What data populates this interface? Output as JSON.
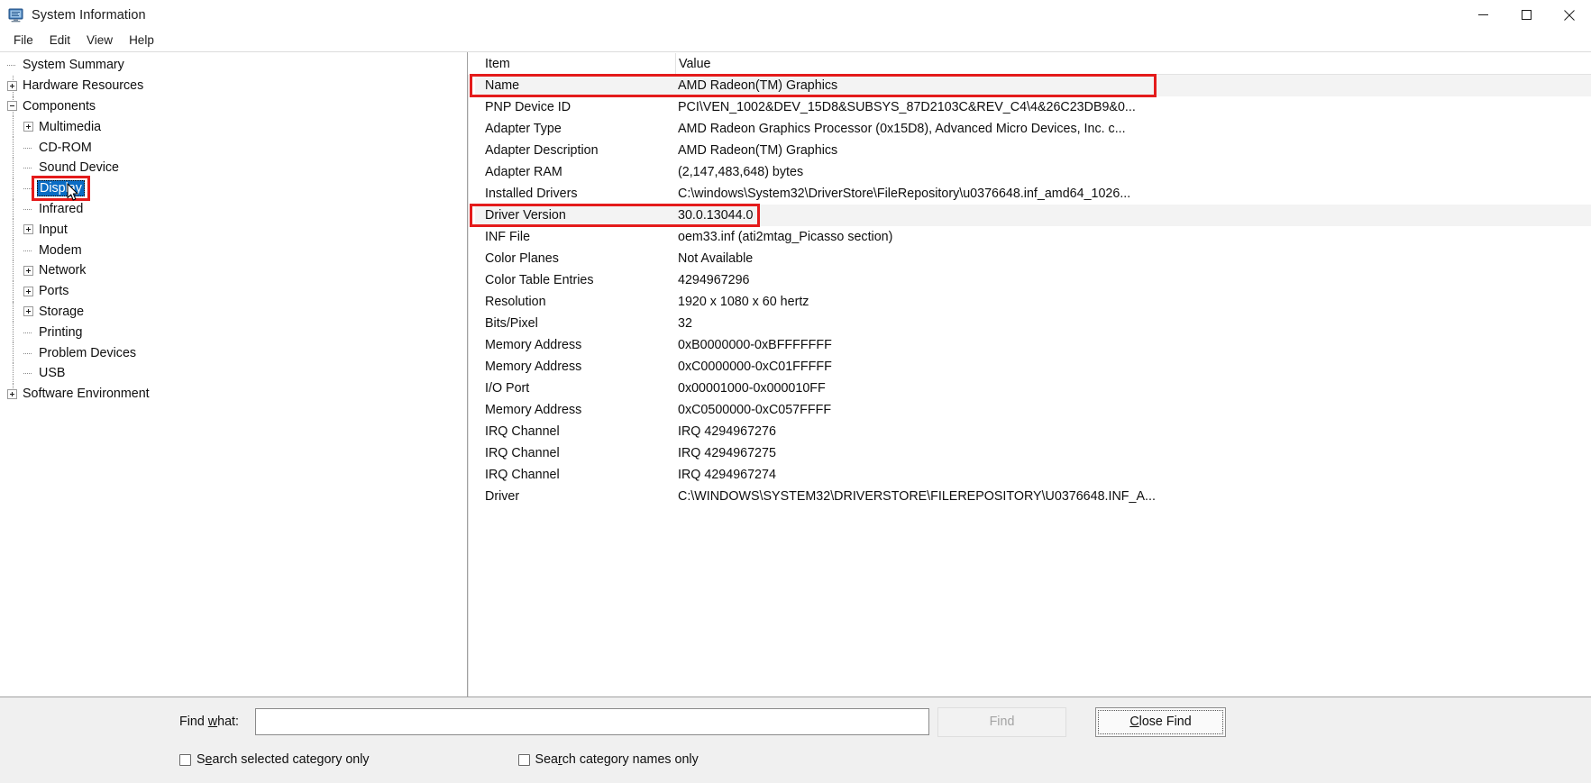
{
  "window": {
    "title": "System Information",
    "icon": "system-information-icon",
    "controls": {
      "minimize": "minimize-icon",
      "maximize": "maximize-icon",
      "close": "close-icon"
    }
  },
  "menubar": {
    "items": [
      "File",
      "Edit",
      "View",
      "Help"
    ]
  },
  "tree": {
    "items": [
      {
        "label": "System Summary",
        "depth": 0,
        "expander": "none",
        "selected": false
      },
      {
        "label": "Hardware Resources",
        "depth": 0,
        "expander": "plus",
        "selected": false
      },
      {
        "label": "Components",
        "depth": 0,
        "expander": "minus",
        "selected": false
      },
      {
        "label": "Multimedia",
        "depth": 1,
        "expander": "plus",
        "selected": false
      },
      {
        "label": "CD-ROM",
        "depth": 1,
        "expander": "none",
        "selected": false
      },
      {
        "label": "Sound Device",
        "depth": 1,
        "expander": "none",
        "selected": false
      },
      {
        "label": "Display",
        "depth": 1,
        "expander": "none",
        "selected": true
      },
      {
        "label": "Infrared",
        "depth": 1,
        "expander": "none",
        "selected": false
      },
      {
        "label": "Input",
        "depth": 1,
        "expander": "plus",
        "selected": false
      },
      {
        "label": "Modem",
        "depth": 1,
        "expander": "none",
        "selected": false
      },
      {
        "label": "Network",
        "depth": 1,
        "expander": "plus",
        "selected": false
      },
      {
        "label": "Ports",
        "depth": 1,
        "expander": "plus",
        "selected": false
      },
      {
        "label": "Storage",
        "depth": 1,
        "expander": "plus",
        "selected": false
      },
      {
        "label": "Printing",
        "depth": 1,
        "expander": "none",
        "selected": false
      },
      {
        "label": "Problem Devices",
        "depth": 1,
        "expander": "none",
        "selected": false
      },
      {
        "label": "USB",
        "depth": 1,
        "expander": "none",
        "selected": false
      },
      {
        "label": "Software Environment",
        "depth": 0,
        "expander": "plus",
        "selected": false
      }
    ]
  },
  "list": {
    "columns": [
      "Item",
      "Value"
    ],
    "rows": [
      {
        "item": "Name",
        "value": "AMD Radeon(TM) Graphics",
        "highlighted": true
      },
      {
        "item": "PNP Device ID",
        "value": "PCI\\VEN_1002&DEV_15D8&SUBSYS_87D2103C&REV_C4\\4&26C23DB9&0...",
        "highlighted": false
      },
      {
        "item": "Adapter Type",
        "value": "AMD Radeon Graphics Processor (0x15D8), Advanced Micro Devices, Inc. c...",
        "highlighted": false
      },
      {
        "item": "Adapter Description",
        "value": "AMD Radeon(TM) Graphics",
        "highlighted": false
      },
      {
        "item": "Adapter RAM",
        "value": "(2,147,483,648) bytes",
        "highlighted": false
      },
      {
        "item": "Installed Drivers",
        "value": "C:\\windows\\System32\\DriverStore\\FileRepository\\u0376648.inf_amd64_1026...",
        "highlighted": false
      },
      {
        "item": "Driver Version",
        "value": "30.0.13044.0",
        "highlighted": true
      },
      {
        "item": "INF File",
        "value": "oem33.inf (ati2mtag_Picasso section)",
        "highlighted": false
      },
      {
        "item": "Color Planes",
        "value": "Not Available",
        "highlighted": false
      },
      {
        "item": "Color Table Entries",
        "value": "4294967296",
        "highlighted": false
      },
      {
        "item": "Resolution",
        "value": "1920 x 1080 x 60 hertz",
        "highlighted": false
      },
      {
        "item": "Bits/Pixel",
        "value": "32",
        "highlighted": false
      },
      {
        "item": "Memory Address",
        "value": "0xB0000000-0xBFFFFFFF",
        "highlighted": false
      },
      {
        "item": "Memory Address",
        "value": "0xC0000000-0xC01FFFFF",
        "highlighted": false
      },
      {
        "item": "I/O Port",
        "value": "0x00001000-0x000010FF",
        "highlighted": false
      },
      {
        "item": "Memory Address",
        "value": "0xC0500000-0xC057FFFF",
        "highlighted": false
      },
      {
        "item": "IRQ Channel",
        "value": "IRQ 4294967276",
        "highlighted": false
      },
      {
        "item": "IRQ Channel",
        "value": "IRQ 4294967275",
        "highlighted": false
      },
      {
        "item": "IRQ Channel",
        "value": "IRQ 4294967274",
        "highlighted": false
      },
      {
        "item": "Driver",
        "value": "C:\\WINDOWS\\SYSTEM32\\DRIVERSTORE\\FILEREPOSITORY\\U0376648.INF_A...",
        "highlighted": false
      }
    ]
  },
  "findbar": {
    "label_prefix": "Find ",
    "label_accel": "w",
    "label_suffix": "hat:",
    "input_value": "",
    "input_placeholder": "",
    "find_button": "Find",
    "find_button_enabled": false,
    "close_find_button_prefix": "C",
    "close_find_button_rest": "lose Find",
    "checkbox1": {
      "prefix": "S",
      "accel": "e",
      "rest": "arch selected category only",
      "checked": false
    },
    "checkbox2": {
      "prefix": "Sea",
      "accel": "r",
      "rest": "ch category names only",
      "checked": false
    }
  },
  "colors": {
    "selection_blue": "#0a6cc4",
    "annotation_red": "#e41b1b",
    "alt_row": "#f3f3f3",
    "chrome": "#f0f0f0"
  }
}
